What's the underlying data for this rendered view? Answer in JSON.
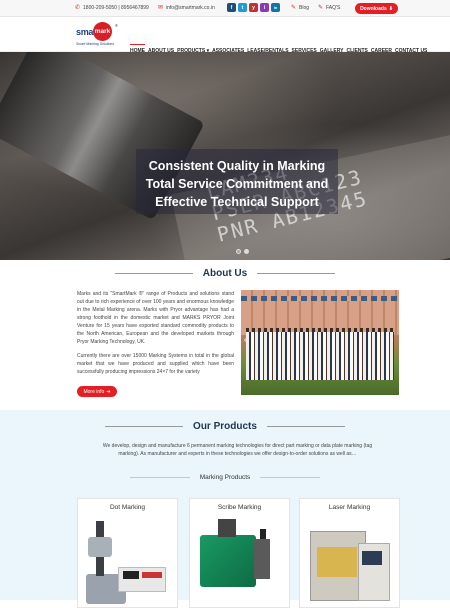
{
  "topbar": {
    "phone": "1800-209-5050 | 8956467899",
    "email": "info@smartmark.co.in",
    "social": [
      "f",
      "t",
      "y",
      "i",
      "in"
    ],
    "blog": "Blog",
    "faqs": "FAQ'S",
    "downloads": "Downloads"
  },
  "brand": {
    "smart": "smart",
    "mark": "mark",
    "reg": "®",
    "tagline": "Smart Marking Solutions"
  },
  "nav": [
    "HOME",
    "ABOUT US",
    "PRODUCTS",
    "ASSOCIATES",
    "LEASE/RENTALS",
    "SERVICES",
    "GALLERY",
    "CLIENTS",
    "CAREER",
    "CONTACT US"
  ],
  "hero": {
    "line1": "Consistent Quality in Marking",
    "line2": "Total Service Commitment and",
    "line3": "Effective Technical Support",
    "plate_text": "LAM234\nPSER ABC123\nPNR AB12345"
  },
  "about": {
    "title": "About Us",
    "para1": "Marks and its \"SmartMark ®\" range of Products and solutions stand out due to rich experience of over 100 years and enormous knowledge in the Metal Marking arena. Marks with Pryor advantage has had a strong foothold in the domestic market and MARKS PRYOR Joint Venture for 15 years have exported standard commodity products to the North American, European and the developed markets through Pryor Marking Technology, UK.",
    "para2": "Currently there are over 15000 Marking Systems in total in the global market that we have produced and supplied which have been successfully producing impressions 24×7 for the variety",
    "more": "More info"
  },
  "products": {
    "title": "Our Products",
    "desc": "We develop, design and manufacture 6 permanent marking technologies for direct part marking or data plate marking (tag marking). As manufacturer and experts in these technologies we offer design-to-order solutions as well as…",
    "subtitle": "Marking Products",
    "cards": [
      "Dot Marking",
      "Scribe Marking",
      "Laser Marking"
    ]
  }
}
